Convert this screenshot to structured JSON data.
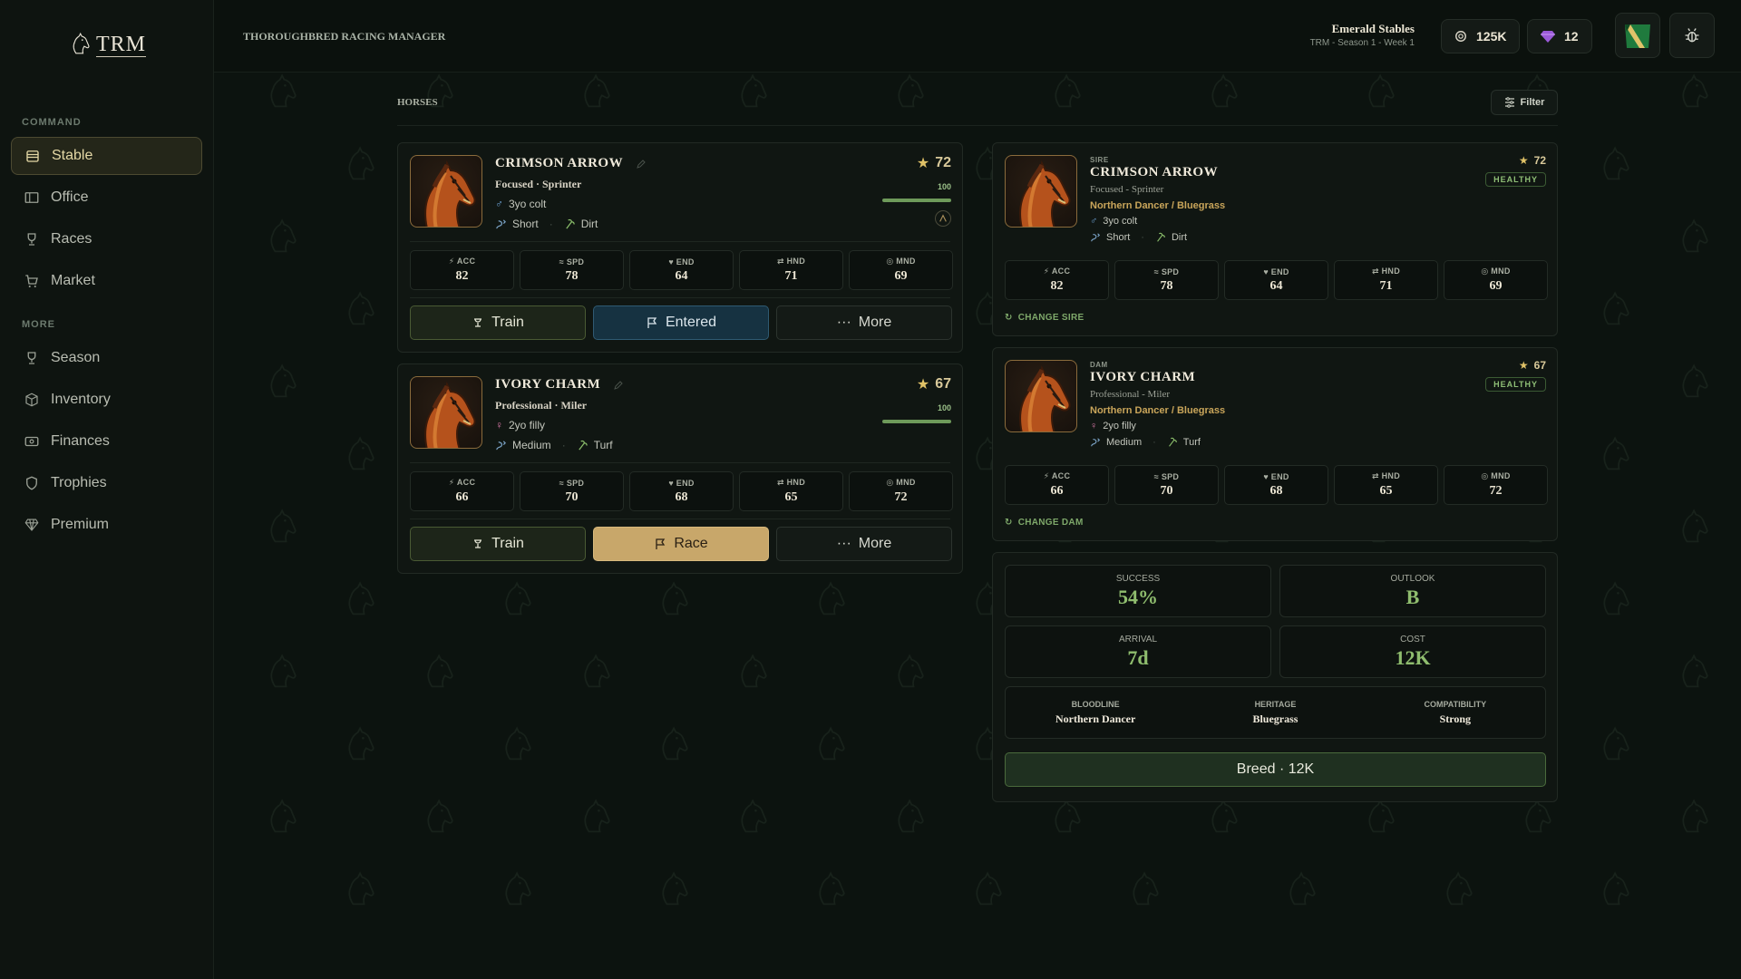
{
  "app": {
    "logo_text": "TRM",
    "title": "THOROUGHBRED RACING MANAGER"
  },
  "sidebar": {
    "command_label": "COMMAND",
    "more_label": "MORE",
    "items": [
      {
        "label": "Stable",
        "icon": "stable-icon"
      },
      {
        "label": "Office",
        "icon": "office-icon"
      },
      {
        "label": "Races",
        "icon": "trophy-icon"
      },
      {
        "label": "Market",
        "icon": "cart-icon"
      },
      {
        "label": "Season",
        "icon": "trophy-icon"
      },
      {
        "label": "Inventory",
        "icon": "box-icon"
      },
      {
        "label": "Finances",
        "icon": "cash-icon"
      },
      {
        "label": "Trophies",
        "icon": "shield-icon"
      },
      {
        "label": "Premium",
        "icon": "gem-icon"
      }
    ]
  },
  "header": {
    "stable_name": "Emerald Stables",
    "stable_sub": "TRM - Season 1 - Week 1",
    "coins": "125K",
    "gems": "12"
  },
  "main": {
    "section_title": "HORSES",
    "filter_label": "Filter"
  },
  "stat_labels": [
    "ACC",
    "SPD",
    "END",
    "HND",
    "MND"
  ],
  "horses": [
    {
      "name": "CRIMSON ARROW",
      "traits": "Focused · Sprinter",
      "age": "3yo colt",
      "distance": "Short",
      "surface": "Dirt",
      "rating": "72",
      "condition": "100",
      "condition_level": 1.0,
      "stats": [
        "82",
        "78",
        "64",
        "71",
        "69"
      ],
      "train_label": "Train",
      "race_label": "Entered",
      "more_label": "More"
    },
    {
      "name": "IVORY CHARM",
      "traits": "Professional · Miler",
      "age": "2yo filly",
      "distance": "Medium",
      "surface": "Turf",
      "rating": "67",
      "condition": "100",
      "condition_level": 1.0,
      "stats": [
        "66",
        "70",
        "68",
        "65",
        "72"
      ],
      "train_label": "Train",
      "race_label": "Race",
      "more_label": "More"
    }
  ],
  "breeding": {
    "sire": {
      "role": "SIRE",
      "name": "CRIMSON ARROW",
      "traits": "Focused - Sprinter",
      "pedigree": "Northern Dancer / Bluegrass",
      "age": "3yo colt",
      "distance": "Short",
      "surface": "Dirt",
      "rating": "72",
      "health": "HEALTHY",
      "stats": [
        "82",
        "78",
        "64",
        "71",
        "69"
      ],
      "change_label": "CHANGE SIRE"
    },
    "dam": {
      "role": "DAM",
      "name": "IVORY CHARM",
      "traits": "Professional - Miler",
      "pedigree": "Northern Dancer / Bluegrass",
      "age": "2yo filly",
      "distance": "Medium",
      "surface": "Turf",
      "rating": "67",
      "health": "HEALTHY",
      "stats": [
        "66",
        "70",
        "68",
        "65",
        "72"
      ],
      "change_label": "CHANGE DAM"
    },
    "success_label": "SUCCESS",
    "success": "54%",
    "outlook_label": "OUTLOOK",
    "outlook": "B",
    "arrival_label": "ARRIVAL",
    "arrival": "7d",
    "cost_label": "COST",
    "cost": "12K",
    "bloodline_label": "BLOODLINE",
    "bloodline": "Northern Dancer",
    "heritage_label": "HERITAGE",
    "heritage": "Bluegrass",
    "compat_label": "COMPATIBILITY",
    "compat": "Strong",
    "breed_button": "Breed · 12K"
  },
  "colors": {
    "accent_gold": "#c8a76a",
    "healthy_green": "#8fbf76",
    "entered_blue": "#163241",
    "background": "#0c130f"
  }
}
